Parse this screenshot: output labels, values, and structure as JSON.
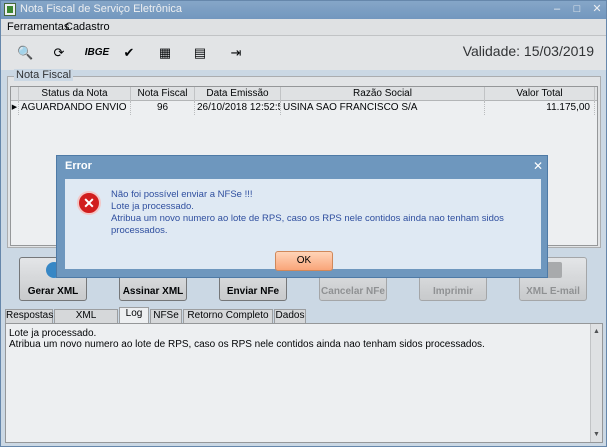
{
  "window": {
    "title": "Nota Fiscal de Serviço Eletrônica"
  },
  "menu": {
    "items": [
      "Ferramentas",
      "Cadastro"
    ]
  },
  "toolbar": {
    "icons": [
      "zoom-icon",
      "refresh-icon",
      "ibge-icon",
      "check-icon",
      "calculator-icon",
      "calendar-icon",
      "exit-icon"
    ],
    "ibge_label": "IBGE",
    "validity": "Validade: 15/03/2019"
  },
  "nota_fiscal": {
    "legend": "Nota Fiscal",
    "columns": [
      "Status da Nota",
      "Nota Fiscal",
      "Data Emissão",
      "Razão Social",
      "Valor Total"
    ],
    "rows": [
      {
        "status": "AGUARDANDO ENVIO",
        "nota": "96",
        "data": "26/10/2018 12:52:59",
        "razao": "USINA SAO FRANCISCO S/A",
        "valor": "11.175,00"
      }
    ]
  },
  "buttons": {
    "gerar": "Gerar XML",
    "assinar": "Assinar XML",
    "enviar": "Enviar NFe",
    "cancelar": "Cancelar NFe",
    "imprimir": "Imprimir",
    "email": "XML E-mail"
  },
  "tabs": [
    "Respostas",
    "XML Resposta",
    "Log",
    "NFSe",
    "Retorno Completo WS",
    "Dados"
  ],
  "active_tab": "Log",
  "log": {
    "lines": [
      "Lote ja processado.",
      "Atribua um novo numero ao lote de RPS, caso os RPS nele contidos ainda nao tenham sidos processados."
    ]
  },
  "dialog": {
    "title": "Error",
    "message": [
      "Não foi possível enviar a NFSe !!!",
      "Lote ja processado.",
      "Atribua um novo numero ao lote de RPS, caso os RPS nele contidos ainda nao tenham sidos processados."
    ],
    "ok_label": "OK"
  },
  "colors": {
    "dialog_bg": "#6e97be",
    "ok_button": "#f9a579",
    "error_icon": "#d11d1d"
  }
}
